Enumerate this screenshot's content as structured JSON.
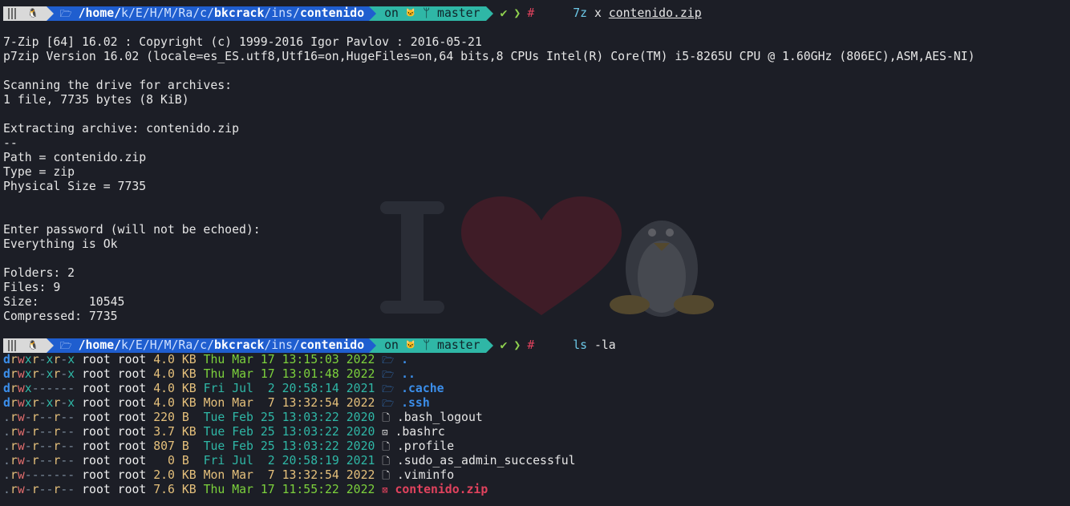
{
  "prompt": {
    "os_icon": "tux-icon",
    "folder_icon": "folder-icon",
    "path_segments": [
      "/home/",
      "k",
      "/",
      "E",
      "/",
      "H",
      "/",
      "M",
      "/",
      "Ra",
      "/",
      "c",
      "/",
      "bkcrack",
      "/",
      "ins",
      "/",
      "contenido"
    ],
    "on": "on",
    "git_icon": "github-icon",
    "branch_icon": "branch-icon",
    "branch": "master",
    "check": "✔",
    "chevron": "❯",
    "hash": "#"
  },
  "cmd1": {
    "prog": "7z",
    "args": "x",
    "file": "contenido.zip"
  },
  "output": [
    "7-Zip [64] 16.02 : Copyright (c) 1999-2016 Igor Pavlov : 2016-05-21",
    "p7zip Version 16.02 (locale=es_ES.utf8,Utf16=on,HugeFiles=on,64 bits,8 CPUs Intel(R) Core(TM) i5-8265U CPU @ 1.60GHz (806EC),ASM,AES-NI)",
    "",
    "Scanning the drive for archives:",
    "1 file, 7735 bytes (8 KiB)",
    "",
    "Extracting archive: contenido.zip",
    "--",
    "Path = contenido.zip",
    "Type = zip",
    "Physical Size = 7735",
    "",
    "",
    "Enter password (will not be echoed):",
    "Everything is Ok",
    "",
    "Folders: 2",
    "Files: 9",
    "Size:       10545",
    "Compressed: 7735",
    ""
  ],
  "cmd2": {
    "prog": "ls",
    "args": "-la"
  },
  "ls": [
    {
      "perm": "drwxr-xr-x",
      "owner": "root root",
      "size": "4.0 KB",
      "date": "Thu Mar 17 13:15:03 2022",
      "age": "new",
      "icon": "folder-icon",
      "name": ".",
      "kind": "dir"
    },
    {
      "perm": "drwxr-xr-x",
      "owner": "root root",
      "size": "4.0 KB",
      "date": "Thu Mar 17 13:01:48 2022",
      "age": "new",
      "icon": "folder-icon",
      "name": "..",
      "kind": "dir"
    },
    {
      "perm": "drwx------",
      "owner": "root root",
      "size": "4.0 KB",
      "date": "Fri Jul  2 20:58:14 2021",
      "age": "old",
      "icon": "folder-icon",
      "name": ".cache",
      "kind": "dir"
    },
    {
      "perm": "drwxr-xr-x",
      "owner": "root root",
      "size": "4.0 KB",
      "date": "Mon Mar  7 13:32:54 2022",
      "age": "mid",
      "icon": "folder-icon",
      "name": ".ssh",
      "kind": "dir"
    },
    {
      "perm": ".rw-r--r--",
      "owner": "root root",
      "size": "220 B ",
      "date": "Tue Feb 25 13:03:22 2020",
      "age": "old",
      "icon": "file-icon",
      "name": ".bash_logout",
      "kind": "file"
    },
    {
      "perm": ".rw-r--r--",
      "owner": "root root",
      "size": "3.7 KB",
      "date": "Tue Feb 25 13:03:22 2020",
      "age": "old",
      "icon": "terminal-file-icon",
      "name": ".bashrc",
      "kind": "file"
    },
    {
      "perm": ".rw-r--r--",
      "owner": "root root",
      "size": "807 B ",
      "date": "Tue Feb 25 13:03:22 2020",
      "age": "old",
      "icon": "file-icon",
      "name": ".profile",
      "kind": "file"
    },
    {
      "perm": ".rw-r--r--",
      "owner": "root root",
      "size": "  0 B ",
      "date": "Fri Jul  2 20:58:19 2021",
      "age": "old",
      "icon": "file-icon",
      "name": ".sudo_as_admin_successful",
      "kind": "file"
    },
    {
      "perm": ".rw-------",
      "owner": "root root",
      "size": "2.0 KB",
      "date": "Mon Mar  7 13:32:54 2022",
      "age": "mid",
      "icon": "file-icon",
      "name": ".viminfo",
      "kind": "file"
    },
    {
      "perm": ".rw-r--r--",
      "owner": "root root",
      "size": "7.6 KB",
      "date": "Thu Mar 17 11:55:22 2022",
      "age": "new",
      "icon": "zip-icon",
      "name": "contenido.zip",
      "kind": "zip"
    }
  ],
  "wallpaper": {
    "letter": "I"
  }
}
